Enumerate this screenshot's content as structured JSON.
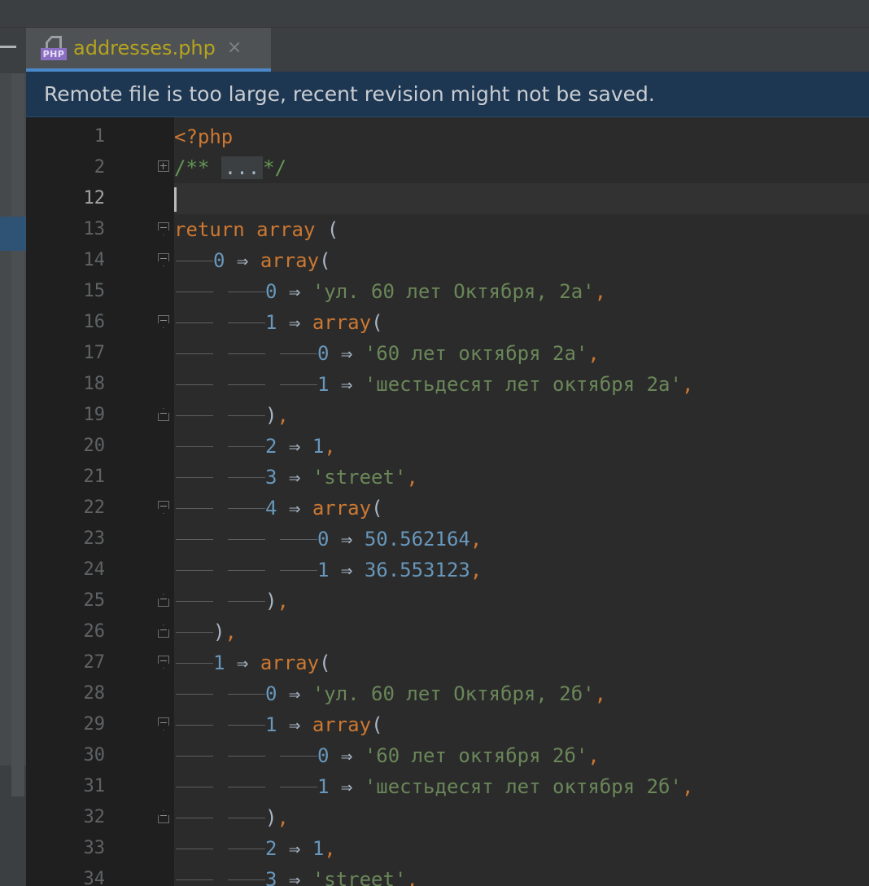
{
  "tab": {
    "file_name": "addresses.php",
    "file_type_badge": "PHP",
    "close_glyph": "×"
  },
  "banner": {
    "message": "Remote file is too large, recent revision might not be saved."
  },
  "colors": {
    "keyword": "#cc7832",
    "number": "#6897bb",
    "string": "#6a8759",
    "comment": "#629755",
    "tab_name": "#b5a31f",
    "banner_bg": "#1d3652"
  },
  "lines": [
    {
      "n": "1",
      "fold": "",
      "depth": 0,
      "tokens": [
        [
          "kw",
          "<?php"
        ]
      ]
    },
    {
      "n": "2",
      "fold": "plus",
      "depth": 0,
      "tokens": [
        [
          "cm",
          "/** "
        ],
        [
          "ph",
          "..."
        ],
        [
          "cm",
          "*/"
        ]
      ]
    },
    {
      "n": "12",
      "fold": "",
      "depth": 0,
      "current": true,
      "tokens": [
        [
          "caret",
          ""
        ]
      ]
    },
    {
      "n": "13",
      "fold": "down",
      "depth": 0,
      "tokens": [
        [
          "kw",
          "return "
        ],
        [
          "kw",
          "array "
        ],
        [
          "op",
          "("
        ]
      ]
    },
    {
      "n": "14",
      "fold": "down",
      "depth": 1,
      "tokens": [
        [
          "num",
          "0"
        ],
        [
          "op",
          " ⇒ "
        ],
        [
          "kw",
          "array"
        ],
        [
          "op",
          "("
        ]
      ]
    },
    {
      "n": "15",
      "fold": "",
      "depth": 2,
      "tokens": [
        [
          "num",
          "0"
        ],
        [
          "op",
          " ⇒ "
        ],
        [
          "str",
          "'ул. 60 лет Октября, 2а'"
        ],
        [
          "kw",
          ","
        ]
      ]
    },
    {
      "n": "16",
      "fold": "down",
      "depth": 2,
      "tokens": [
        [
          "num",
          "1"
        ],
        [
          "op",
          " ⇒ "
        ],
        [
          "kw",
          "array"
        ],
        [
          "op",
          "("
        ]
      ]
    },
    {
      "n": "17",
      "fold": "",
      "depth": 3,
      "tokens": [
        [
          "num",
          "0"
        ],
        [
          "op",
          " ⇒ "
        ],
        [
          "str",
          "'60 лет октября 2а'"
        ],
        [
          "kw",
          ","
        ]
      ]
    },
    {
      "n": "18",
      "fold": "",
      "depth": 3,
      "tokens": [
        [
          "num",
          "1"
        ],
        [
          "op",
          " ⇒ "
        ],
        [
          "str",
          "'шестьдесят лет октября 2а'"
        ],
        [
          "kw",
          ","
        ]
      ]
    },
    {
      "n": "19",
      "fold": "up",
      "depth": 2,
      "tokens": [
        [
          "op",
          ")"
        ],
        [
          "kw",
          ","
        ]
      ]
    },
    {
      "n": "20",
      "fold": "",
      "depth": 2,
      "tokens": [
        [
          "num",
          "2"
        ],
        [
          "op",
          " ⇒ "
        ],
        [
          "num",
          "1"
        ],
        [
          "kw",
          ","
        ]
      ]
    },
    {
      "n": "21",
      "fold": "",
      "depth": 2,
      "tokens": [
        [
          "num",
          "3"
        ],
        [
          "op",
          " ⇒ "
        ],
        [
          "str",
          "'street'"
        ],
        [
          "kw",
          ","
        ]
      ]
    },
    {
      "n": "22",
      "fold": "down",
      "depth": 2,
      "tokens": [
        [
          "num",
          "4"
        ],
        [
          "op",
          " ⇒ "
        ],
        [
          "kw",
          "array"
        ],
        [
          "op",
          "("
        ]
      ]
    },
    {
      "n": "23",
      "fold": "",
      "depth": 3,
      "tokens": [
        [
          "num",
          "0"
        ],
        [
          "op",
          " ⇒ "
        ],
        [
          "num",
          "50.562164"
        ],
        [
          "kw",
          ","
        ]
      ]
    },
    {
      "n": "24",
      "fold": "",
      "depth": 3,
      "tokens": [
        [
          "num",
          "1"
        ],
        [
          "op",
          " ⇒ "
        ],
        [
          "num",
          "36.553123"
        ],
        [
          "kw",
          ","
        ]
      ]
    },
    {
      "n": "25",
      "fold": "up",
      "depth": 2,
      "tokens": [
        [
          "op",
          ")"
        ],
        [
          "kw",
          ","
        ]
      ]
    },
    {
      "n": "26",
      "fold": "up",
      "depth": 1,
      "tokens": [
        [
          "op",
          ")"
        ],
        [
          "kw",
          ","
        ]
      ]
    },
    {
      "n": "27",
      "fold": "down",
      "depth": 1,
      "tokens": [
        [
          "num",
          "1"
        ],
        [
          "op",
          " ⇒ "
        ],
        [
          "kw",
          "array"
        ],
        [
          "op",
          "("
        ]
      ]
    },
    {
      "n": "28",
      "fold": "",
      "depth": 2,
      "tokens": [
        [
          "num",
          "0"
        ],
        [
          "op",
          " ⇒ "
        ],
        [
          "str",
          "'ул. 60 лет Октября, 2б'"
        ],
        [
          "kw",
          ","
        ]
      ]
    },
    {
      "n": "29",
      "fold": "down",
      "depth": 2,
      "tokens": [
        [
          "num",
          "1"
        ],
        [
          "op",
          " ⇒ "
        ],
        [
          "kw",
          "array"
        ],
        [
          "op",
          "("
        ]
      ]
    },
    {
      "n": "30",
      "fold": "",
      "depth": 3,
      "tokens": [
        [
          "num",
          "0"
        ],
        [
          "op",
          " ⇒ "
        ],
        [
          "str",
          "'60 лет октября 2б'"
        ],
        [
          "kw",
          ","
        ]
      ]
    },
    {
      "n": "31",
      "fold": "",
      "depth": 3,
      "tokens": [
        [
          "num",
          "1"
        ],
        [
          "op",
          " ⇒ "
        ],
        [
          "str",
          "'шестьдесят лет октября 2б'"
        ],
        [
          "kw",
          ","
        ]
      ]
    },
    {
      "n": "32",
      "fold": "up",
      "depth": 2,
      "tokens": [
        [
          "op",
          ")"
        ],
        [
          "kw",
          ","
        ]
      ]
    },
    {
      "n": "33",
      "fold": "",
      "depth": 2,
      "tokens": [
        [
          "num",
          "2"
        ],
        [
          "op",
          " ⇒ "
        ],
        [
          "num",
          "1"
        ],
        [
          "kw",
          ","
        ]
      ]
    },
    {
      "n": "34",
      "fold": "",
      "depth": 2,
      "tokens": [
        [
          "num",
          "3"
        ],
        [
          "op",
          " ⇒ "
        ],
        [
          "str",
          "'street'"
        ],
        [
          "kw",
          ","
        ]
      ]
    }
  ]
}
